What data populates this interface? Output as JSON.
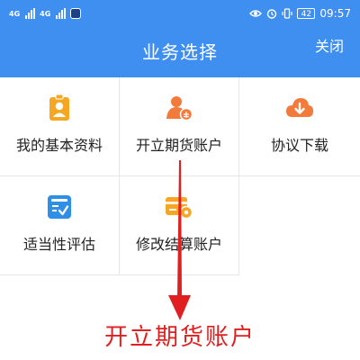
{
  "status_bar": {
    "network_left_1": "4G",
    "network_left_2": "4G",
    "battery": "42",
    "time": "09:57",
    "icons": [
      "signal-icon",
      "signal-icon",
      "app-notification-icon",
      "eye-icon",
      "alarm-icon",
      "vibrate-icon",
      "battery-icon"
    ]
  },
  "header": {
    "title": "业务选择",
    "close_label": "关闭",
    "background": "#3f8ff0"
  },
  "menu": {
    "items": [
      {
        "label": "我的基本资料",
        "icon": "profile-badge-icon",
        "color": "#f5a623"
      },
      {
        "label": "开立期货账户",
        "icon": "user-open-account-icon",
        "color": "#f27a3a"
      },
      {
        "label": "协议下载",
        "icon": "cloud-download-icon",
        "color": "#f27a3a"
      },
      {
        "label": "适当性评估",
        "icon": "assessment-checklist-icon",
        "color": "#2d8fe6"
      },
      {
        "label": "修改结算账户",
        "icon": "bank-card-settings-icon",
        "color": "#f5a623"
      }
    ]
  },
  "annotation": {
    "caption": "开立期货账户",
    "color": "#e02020"
  }
}
